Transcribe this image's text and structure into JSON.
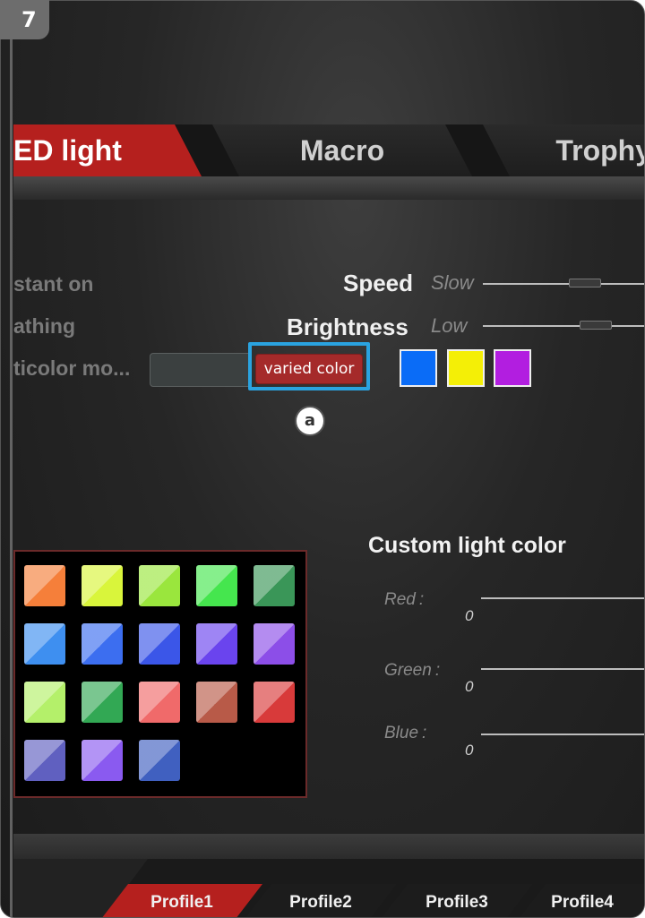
{
  "step_badge": "7",
  "tabs": [
    {
      "label": "ED light",
      "active": true
    },
    {
      "label": "Macro",
      "active": false
    },
    {
      "label": "Trophy",
      "active": false
    }
  ],
  "modes": [
    {
      "label": "stant on"
    },
    {
      "label": "athing"
    },
    {
      "label": "ticolor mo..."
    }
  ],
  "speed": {
    "label": "Speed",
    "value_label": "Slow"
  },
  "brightness": {
    "label": "Brightness",
    "value_label": "Low"
  },
  "mode_select": {
    "button_label": "varied color"
  },
  "callout": "a",
  "selected_colors": [
    "#0a6cf7",
    "#f4ef06",
    "#b21ee0"
  ],
  "palette": [
    "#f57f3a",
    "#d9f53b",
    "#9ae63d",
    "#45e64e",
    "#3a9658",
    "#3e8ff0",
    "#3c6ef0",
    "#3b56e8",
    "#6a44ee",
    "#8c4ee8",
    "#b4f06a",
    "#32a854",
    "#f06a6a",
    "#b85a48",
    "#d83a3a",
    "#6060c0",
    "#8a5af0",
    "#4060c0"
  ],
  "custom_light": {
    "title": "Custom light color",
    "channels": [
      {
        "label": "Red",
        "value": "0"
      },
      {
        "label": "Green",
        "value": "0"
      },
      {
        "label": "Blue",
        "value": "0"
      }
    ],
    "separator": ":"
  },
  "profiles": [
    {
      "label": "Profile1",
      "active": true
    },
    {
      "label": "Profile2",
      "active": false
    },
    {
      "label": "Profile3",
      "active": false
    },
    {
      "label": "Profile4",
      "active": false
    }
  ],
  "colors": {
    "accent": "#b5201e",
    "highlight": "#2aa3e0",
    "button": "#a52a2a"
  }
}
